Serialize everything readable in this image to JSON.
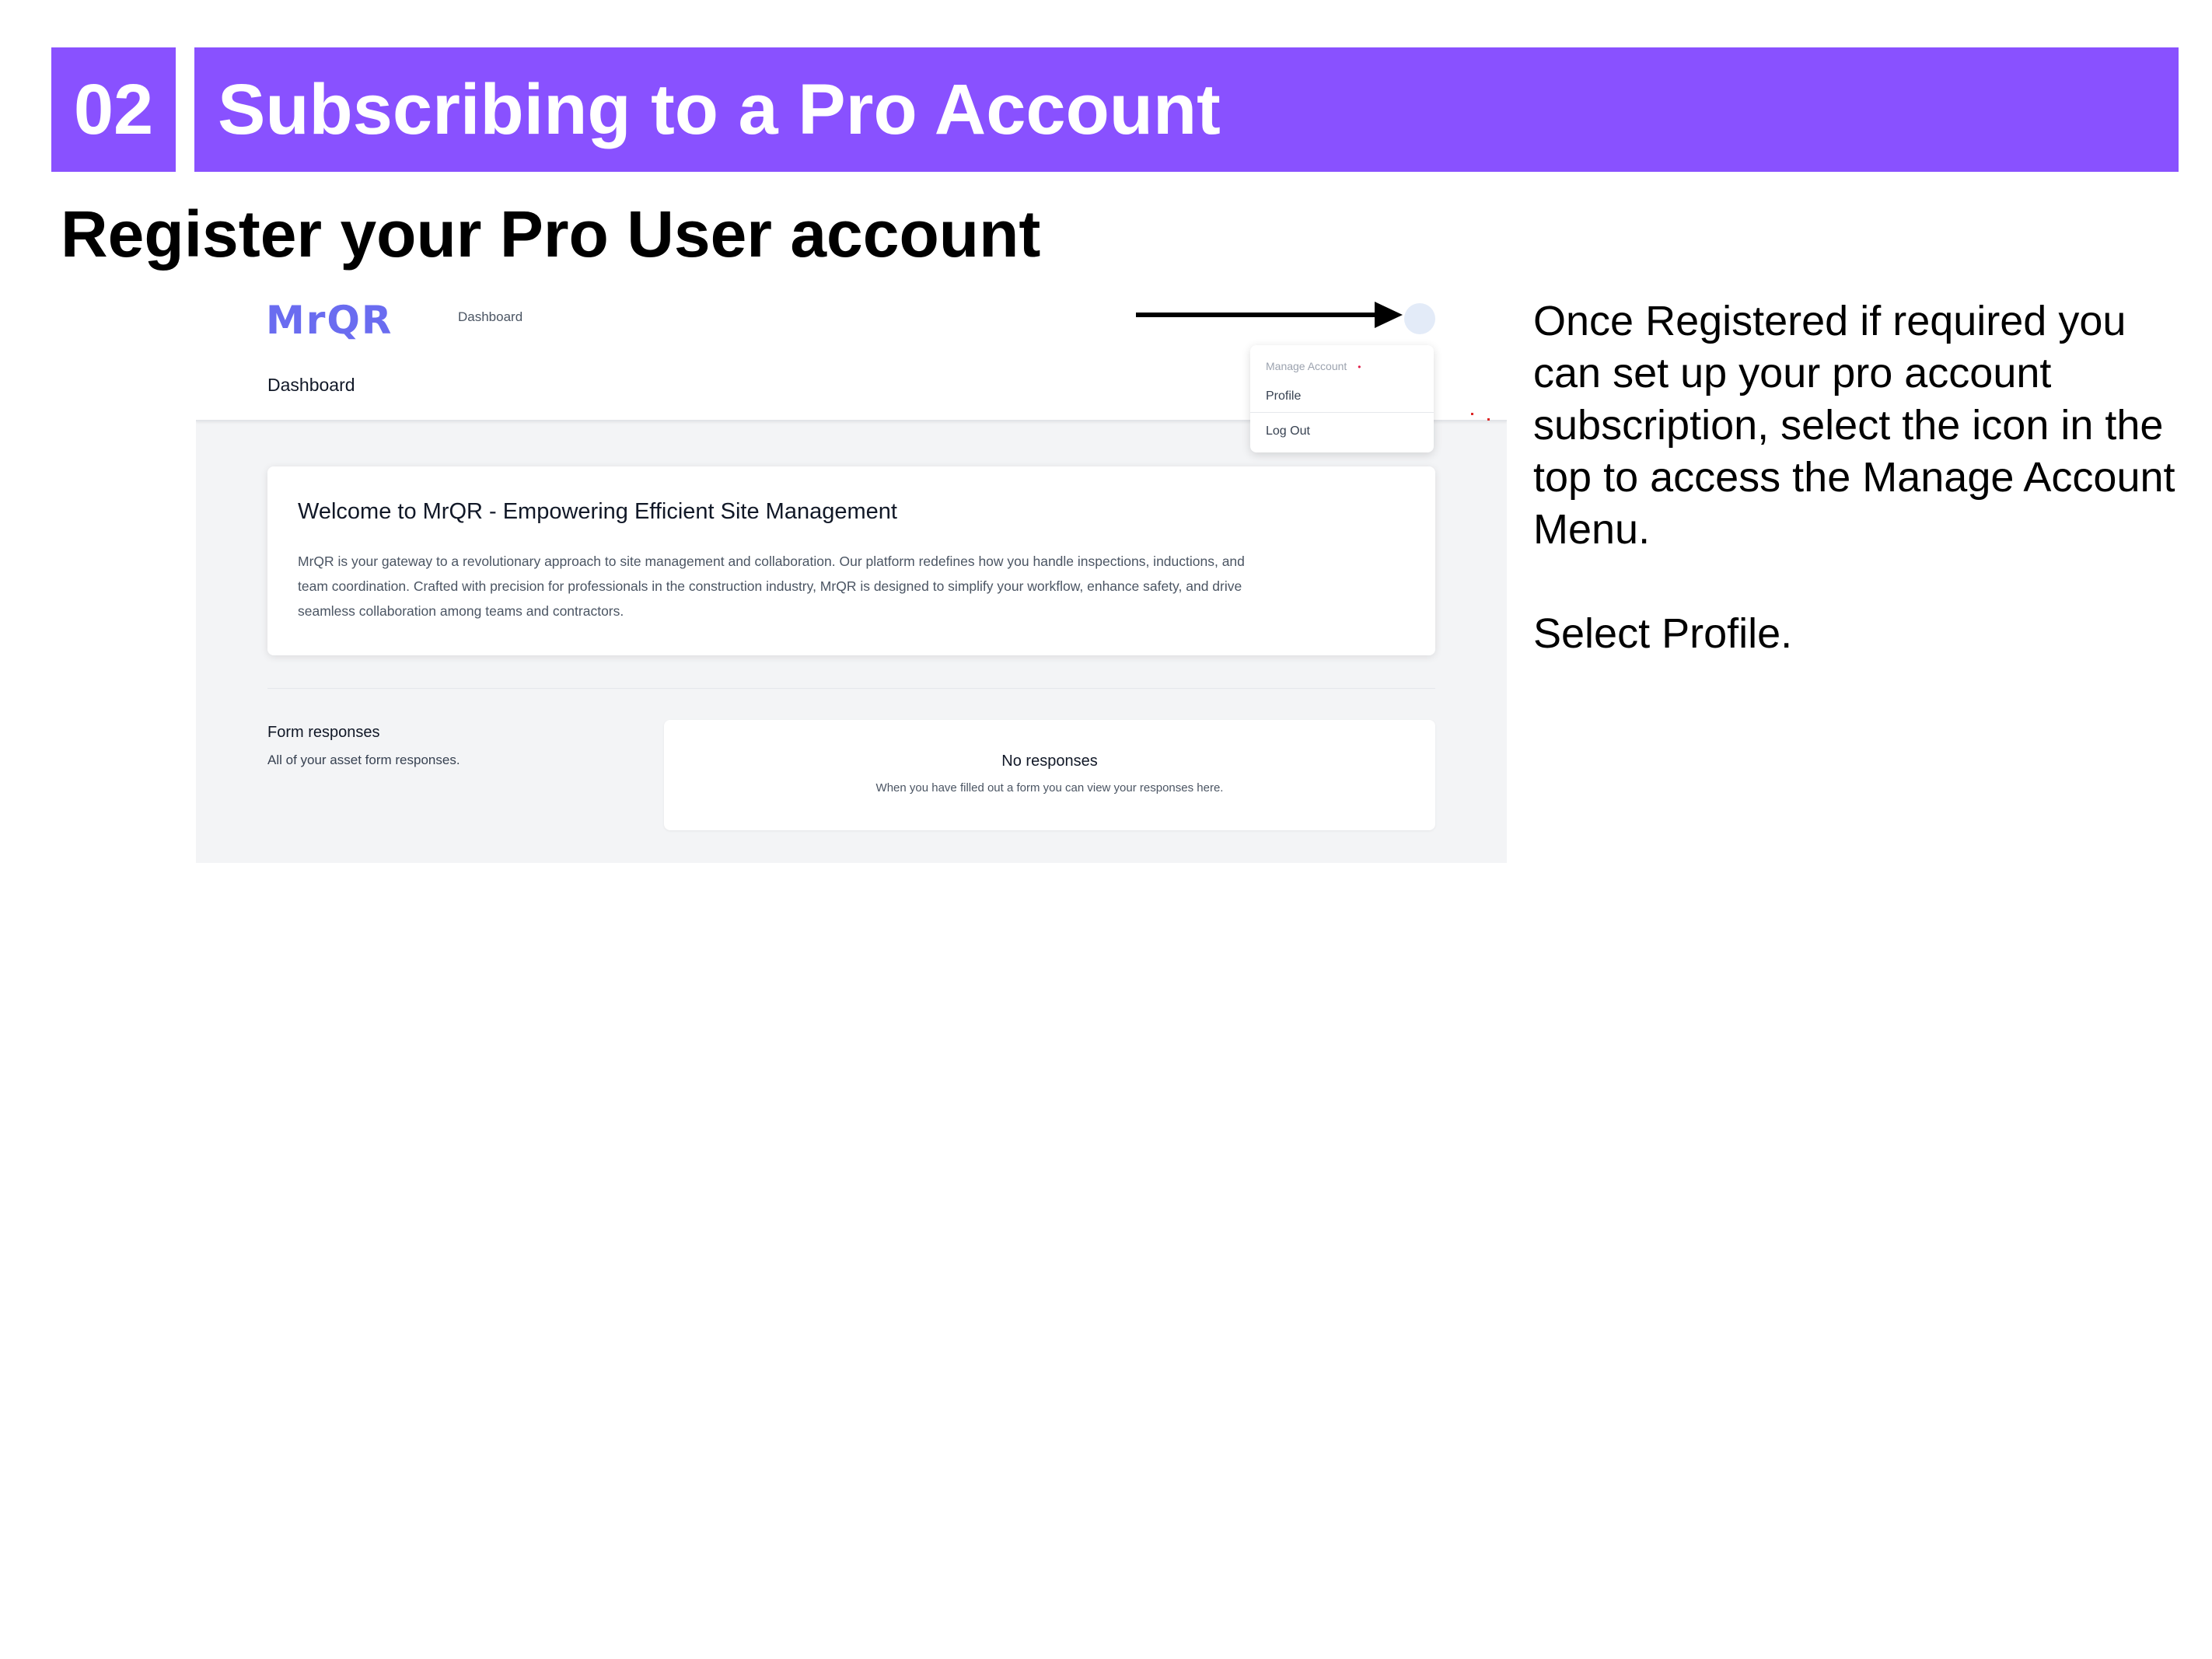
{
  "banner": {
    "step_number": "02",
    "title": "Subscribing to a Pro Account"
  },
  "subheading": "Register your Pro User account",
  "instructions": {
    "paragraph1": "Once Registered if required you can set up your pro account subscription, select the icon in the top to access the Manage Account Menu.",
    "paragraph2": "Select Profile."
  },
  "app": {
    "logo_text": "MrQR",
    "nav_link": "Dashboard",
    "header_title": "Dashboard",
    "dropdown": {
      "header": "Manage Account",
      "items": [
        "Profile",
        "Log Out"
      ]
    },
    "welcome": {
      "title": "Welcome to MrQR - Empowering Efficient Site Management",
      "body_lines": [
        "MrQR is your gateway to a revolutionary approach to site management and collaboration. Our platform redefines how you handle inspections, inductions, and",
        "team coordination. Crafted with precision for professionals in the construction industry, MrQR is designed to simplify your workflow, enhance safety, and drive",
        "seamless collaboration among teams and contractors."
      ]
    },
    "form_responses": {
      "title": "Form responses",
      "subtitle": "All of your asset form responses."
    },
    "empty_state": {
      "title": "No responses",
      "subtitle": "When you have filled out a form you can view your responses here."
    }
  },
  "colors": {
    "banner": "#8951ff",
    "logo": "#6a6cf0",
    "app_background": "#f3f4f6"
  }
}
